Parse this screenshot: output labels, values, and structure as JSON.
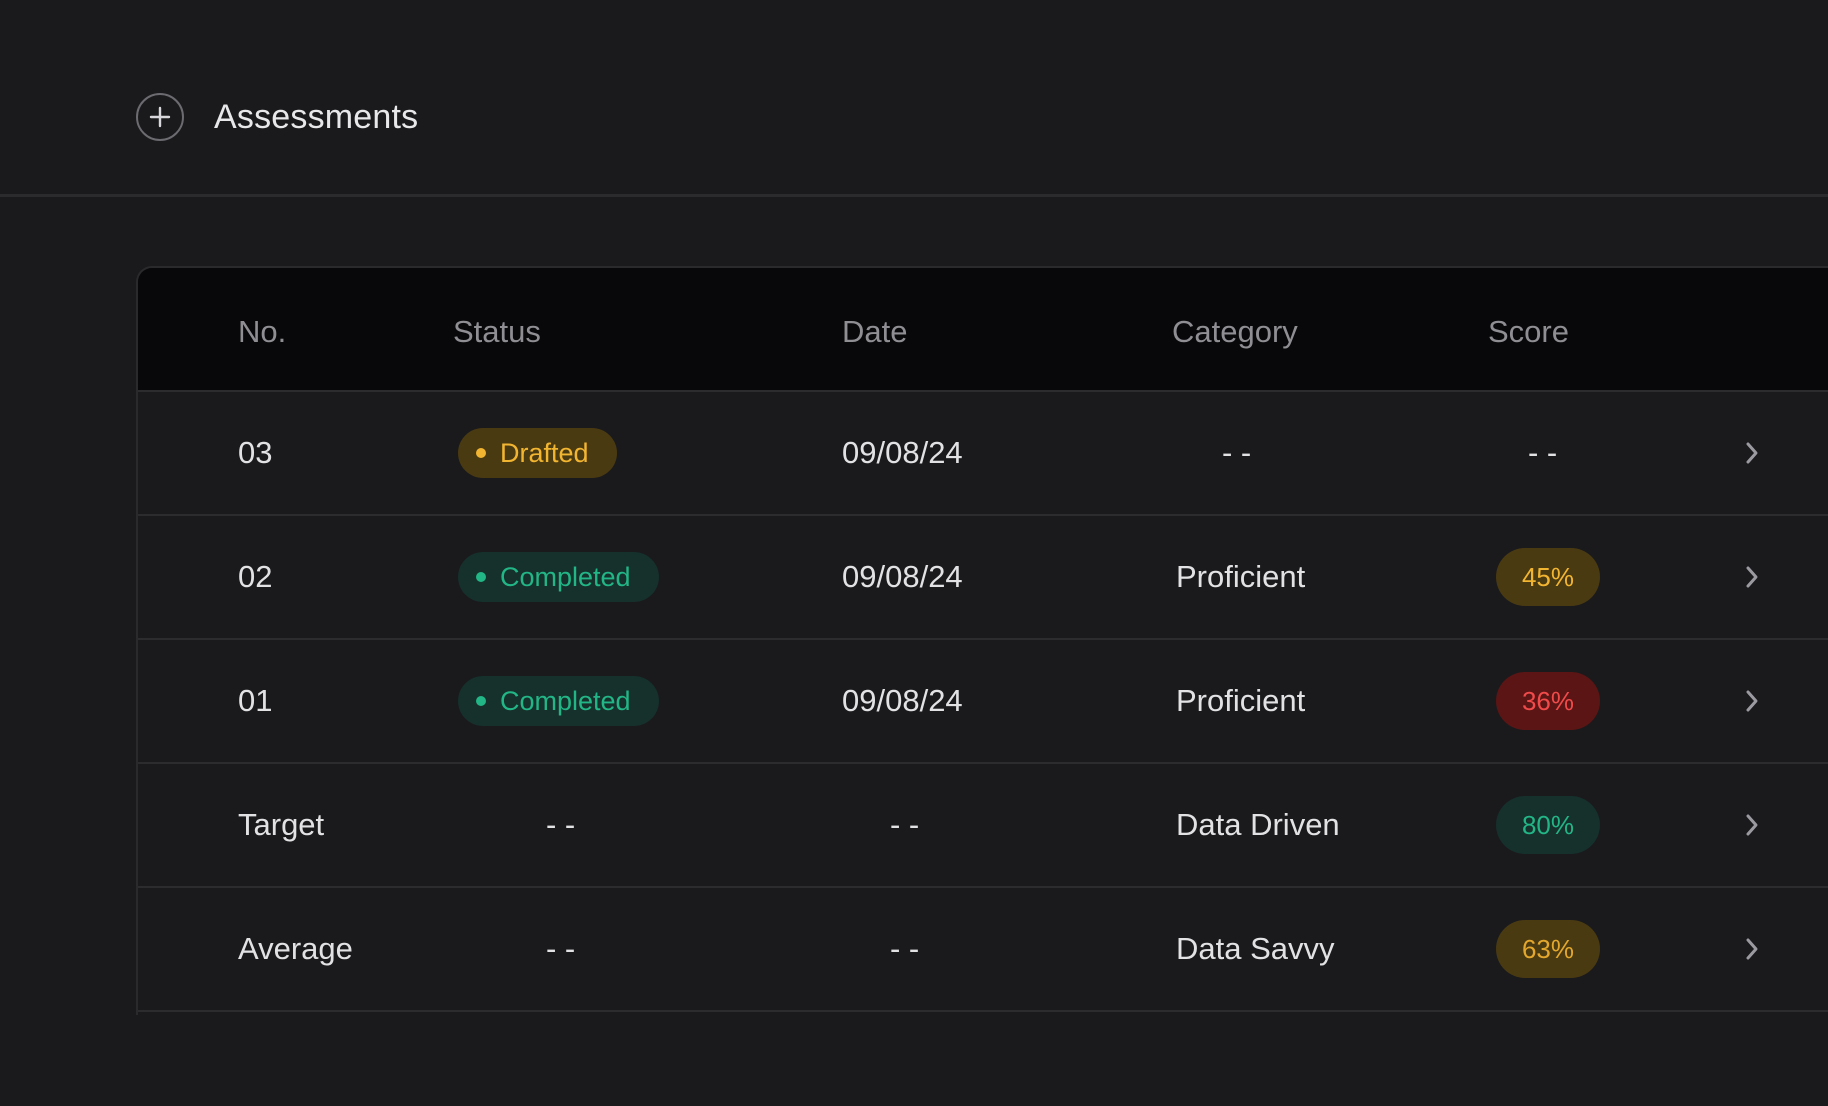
{
  "header": {
    "title": "Assessments",
    "add_icon": "plus-circle-icon"
  },
  "table": {
    "columns": [
      "No.",
      "Status",
      "Date",
      "Category",
      "Score",
      ""
    ],
    "rows": [
      {
        "no": "03",
        "status": "Drafted",
        "status_kind": "drafted",
        "date": "09/08/24",
        "category": "- -",
        "score": "- -",
        "score_kind": ""
      },
      {
        "no": "02",
        "status": "Completed",
        "status_kind": "completed",
        "date": "09/08/24",
        "category": "Proficient",
        "score": "45%",
        "score_kind": "yellow"
      },
      {
        "no": "01",
        "status": "Completed",
        "status_kind": "completed",
        "date": "09/08/24",
        "category": "Proficient",
        "score": "36%",
        "score_kind": "red"
      },
      {
        "no": "Target",
        "status": "- -",
        "status_kind": "",
        "date": "- -",
        "category": "Data Driven",
        "score": "80%",
        "score_kind": "green"
      },
      {
        "no": "Average",
        "status": "- -",
        "status_kind": "",
        "date": "- -",
        "category": "Data Savvy",
        "score": "63%",
        "score_kind": "gold"
      }
    ]
  },
  "icons": {
    "row_action": "chevron-right-icon"
  },
  "colors": {
    "background": "#1a1a1c",
    "header_bg": "#08080a",
    "amber": "#f2b531",
    "green": "#22b585",
    "red": "#f04a4a"
  }
}
